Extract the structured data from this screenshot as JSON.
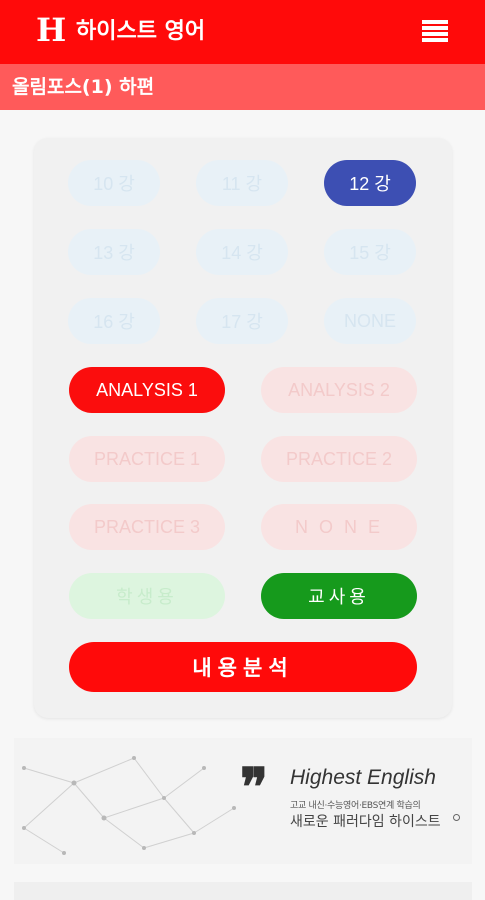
{
  "header": {
    "logo_letter": "H",
    "app_title": "하이스트 영어",
    "menu_icon": "hamburger-menu-icon"
  },
  "subheader": {
    "title": "올림포스(1) 하편"
  },
  "lectures": [
    {
      "label": "10 강",
      "selected": false
    },
    {
      "label": "11 강",
      "selected": false
    },
    {
      "label": "12 강",
      "selected": true
    },
    {
      "label": "13 강",
      "selected": false
    },
    {
      "label": "14 강",
      "selected": false
    },
    {
      "label": "15 강",
      "selected": false
    },
    {
      "label": "16 강",
      "selected": false
    },
    {
      "label": "17 강",
      "selected": false
    },
    {
      "label": "NONE",
      "selected": false
    }
  ],
  "parts": [
    {
      "label": "ANALYSIS 1",
      "selected": true
    },
    {
      "label": "ANALYSIS 2",
      "selected": false
    },
    {
      "label": "PRACTICE 1",
      "selected": false
    },
    {
      "label": "PRACTICE 2",
      "selected": false
    },
    {
      "label": "PRACTICE 3",
      "selected": false
    },
    {
      "label": "N O N E",
      "selected": false
    }
  ],
  "roles": {
    "student": {
      "label": "학생용",
      "selected": false
    },
    "teacher": {
      "label": "교사용",
      "selected": true
    }
  },
  "analyze_button": "내용분석",
  "banner": {
    "quote": "❞",
    "title": "Highest English",
    "subtitle": "고교 내신·수능영어·EBS연계 학습의",
    "slogan": "새로운 패러다임 하이스트"
  },
  "colors": {
    "primary_red": "#ff0a0a",
    "subheader_red": "#ff5a5a",
    "selected_blue": "#3d4fb3",
    "selected_green": "#169a1c"
  }
}
